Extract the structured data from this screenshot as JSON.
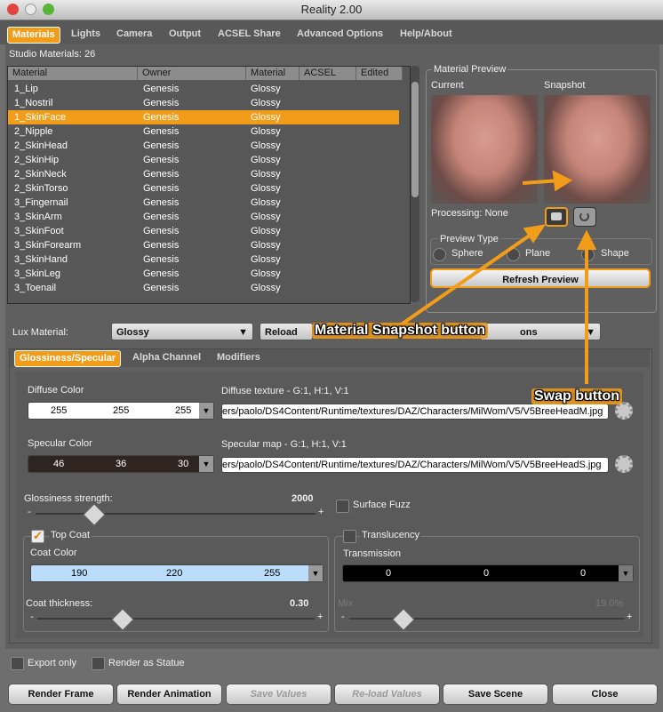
{
  "window": {
    "title": "Reality  2.00"
  },
  "tabs": [
    "Materials",
    "Lights",
    "Camera",
    "Output",
    "ACSEL Share",
    "Advanced Options",
    "Help/About"
  ],
  "materials": {
    "count_label": "Studio Materials: 26",
    "columns": [
      "Material",
      "Owner",
      "Material",
      "ACSEL",
      "Edited"
    ],
    "rows": [
      {
        "name": "1_Lip",
        "owner": "Genesis",
        "type": "Glossy"
      },
      {
        "name": "1_Nostril",
        "owner": "Genesis",
        "type": "Glossy"
      },
      {
        "name": "1_SkinFace",
        "owner": "Genesis",
        "type": "Glossy",
        "selected": true
      },
      {
        "name": "2_Nipple",
        "owner": "Genesis",
        "type": "Glossy"
      },
      {
        "name": "2_SkinHead",
        "owner": "Genesis",
        "type": "Glossy"
      },
      {
        "name": "2_SkinHip",
        "owner": "Genesis",
        "type": "Glossy"
      },
      {
        "name": "2_SkinNeck",
        "owner": "Genesis",
        "type": "Glossy"
      },
      {
        "name": "2_SkinTorso",
        "owner": "Genesis",
        "type": "Glossy"
      },
      {
        "name": "3_Fingernail",
        "owner": "Genesis",
        "type": "Glossy"
      },
      {
        "name": "3_SkinArm",
        "owner": "Genesis",
        "type": "Glossy"
      },
      {
        "name": "3_SkinFoot",
        "owner": "Genesis",
        "type": "Glossy"
      },
      {
        "name": "3_SkinForearm",
        "owner": "Genesis",
        "type": "Glossy"
      },
      {
        "name": "3_SkinHand",
        "owner": "Genesis",
        "type": "Glossy"
      },
      {
        "name": "3_SkinLeg",
        "owner": "Genesis",
        "type": "Glossy"
      },
      {
        "name": "3_Toenail",
        "owner": "Genesis",
        "type": "Glossy"
      }
    ]
  },
  "preview": {
    "title": "Material Preview",
    "current": "Current",
    "snapshot": "Snapshot",
    "processing": "Processing: None",
    "preview_type": "Preview Type",
    "options": [
      "Sphere",
      "Plane",
      "Shape"
    ],
    "refresh": "Refresh Preview"
  },
  "lux": {
    "label": "Lux Material:",
    "value": "Glossy",
    "reload": "Reload Stu",
    "third_tail": "ons"
  },
  "subtabs": [
    "Glossiness/Specular",
    "Alpha Channel",
    "Modifiers"
  ],
  "diffuse": {
    "label": "Diffuse Color",
    "r": "255",
    "g": "255",
    "b": "255",
    "texture_label": "Diffuse texture - G:1, H:1, V:1",
    "texture_path": "ers/paolo/DS4Content/Runtime/textures/DAZ/Characters/MilWom/V5/V5BreeHeadM.jpg"
  },
  "specular": {
    "label": "Specular Color",
    "r": "46",
    "g": "36",
    "b": "30",
    "map_label": "Specular map - G:1, H:1, V:1",
    "map_path": "ers/paolo/DS4Content/Runtime/textures/DAZ/Characters/MilWom/V5/V5BreeHeadS.jpg"
  },
  "glossiness": {
    "label": "Glossiness strength:",
    "value": "2000",
    "minus": "-",
    "plus": "+"
  },
  "surface_fuzz": "Surface Fuzz",
  "topcoat": {
    "label": "Top Coat",
    "coat_color": "Coat Color",
    "r": "190",
    "g": "220",
    "b": "255",
    "thickness_label": "Coat thickness:",
    "thickness": "0.30"
  },
  "translucency": {
    "label": "Translucency",
    "transmission": "Transmission",
    "r": "0",
    "g": "0",
    "b": "0",
    "mix_label": "Mix",
    "mix_value": "19.0%"
  },
  "bottom": {
    "export_only": "Export only",
    "render_statue": "Render as Statue",
    "buttons": [
      "Render Frame",
      "Render Animation",
      "Save Values",
      "Re-load Values",
      "Save Scene",
      "Close"
    ]
  },
  "callouts": {
    "snapshot": "Material Snapshot button",
    "swap": "Swap button"
  },
  "colors": {
    "accent": "#f29d1a",
    "panel": "#5f5f5f"
  }
}
